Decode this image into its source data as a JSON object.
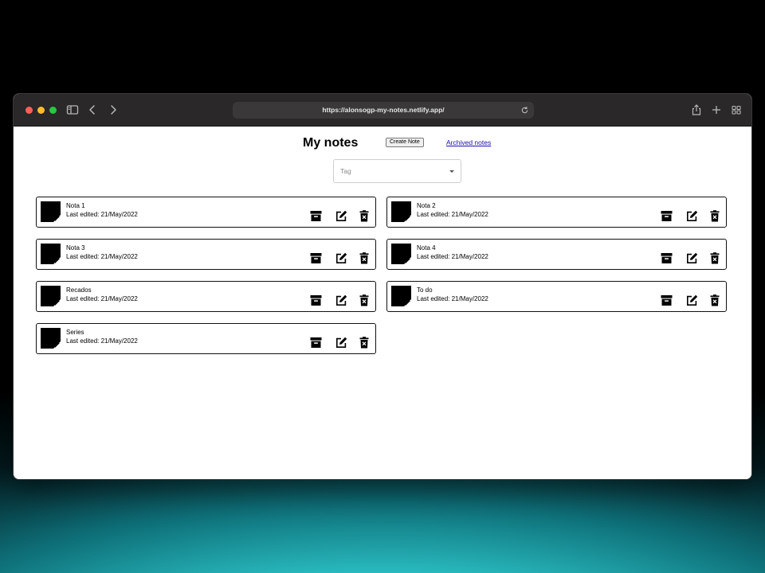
{
  "browser": {
    "url": "https://alonsogp-my-notes.netlify.app/"
  },
  "page": {
    "title": "My notes",
    "create_button": "Create Note",
    "archived_link": "Archived notes",
    "tag_select": {
      "placeholder": "Tag"
    }
  },
  "notes": [
    {
      "title": "Nota 1",
      "last_edited": "Last edited: 21/May/2022"
    },
    {
      "title": "Nota 2",
      "last_edited": "Last edited: 21/May/2022"
    },
    {
      "title": "Nota 3",
      "last_edited": "Last edited: 21/May/2022"
    },
    {
      "title": "Nota 4",
      "last_edited": "Last edited: 21/May/2022"
    },
    {
      "title": "Recados",
      "last_edited": "Last edited: 21/May/2022"
    },
    {
      "title": "To do",
      "last_edited": "Last edited: 21/May/2022"
    },
    {
      "title": "Series",
      "last_edited": "Last edited: 21/May/2022"
    }
  ],
  "icons": {
    "note": "sticky-note-icon",
    "archive": "archive-icon",
    "edit": "edit-icon",
    "delete": "delete-icon"
  },
  "colors": {
    "traffic_red": "#ff5f57",
    "traffic_yellow": "#febc2e",
    "traffic_green": "#28c840",
    "link": "#1a0dab"
  }
}
